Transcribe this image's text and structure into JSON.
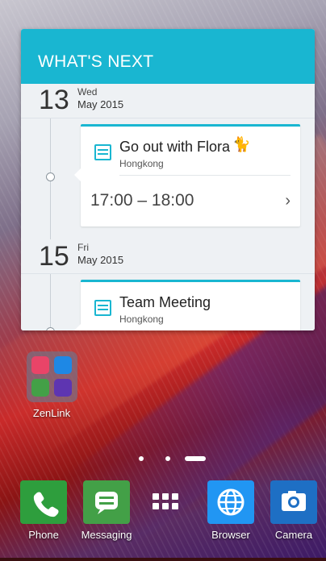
{
  "widget": {
    "title": "WHAT'S NEXT",
    "days": [
      {
        "day_num": "13",
        "dow": "Wed",
        "month_year": "May 2015",
        "event": {
          "title": "Go out with Flora",
          "location": "Hongkong",
          "time": "17:00 – 18:00"
        }
      },
      {
        "day_num": "15",
        "dow": "Fri",
        "month_year": "May 2015",
        "event": {
          "title": "Team Meeting",
          "location": "Hongkong"
        }
      }
    ],
    "accent_color": "#19b6d1"
  },
  "folder": {
    "label": "ZenLink",
    "apps": [
      {
        "icon": "share-link-icon",
        "color": "#e94468"
      },
      {
        "icon": "remote-link-icon",
        "color": "#1e88e5"
      },
      {
        "icon": "party-link-icon",
        "color": "#43a047"
      },
      {
        "icon": "pc-link-icon",
        "color": "#5e35b1"
      }
    ]
  },
  "page_indicator": {
    "pages": 3,
    "current": 3
  },
  "dock": [
    {
      "label": "Phone",
      "icon": "phone-icon",
      "color": "#2e9e3d"
    },
    {
      "label": "Messaging",
      "icon": "message-icon",
      "color": "#43a047"
    },
    {
      "label": "",
      "icon": "all-apps-icon"
    },
    {
      "label": "Browser",
      "icon": "globe-icon",
      "color": "#2196f3"
    },
    {
      "label": "Camera",
      "icon": "camera-icon",
      "color": "#1e6fc4"
    }
  ]
}
